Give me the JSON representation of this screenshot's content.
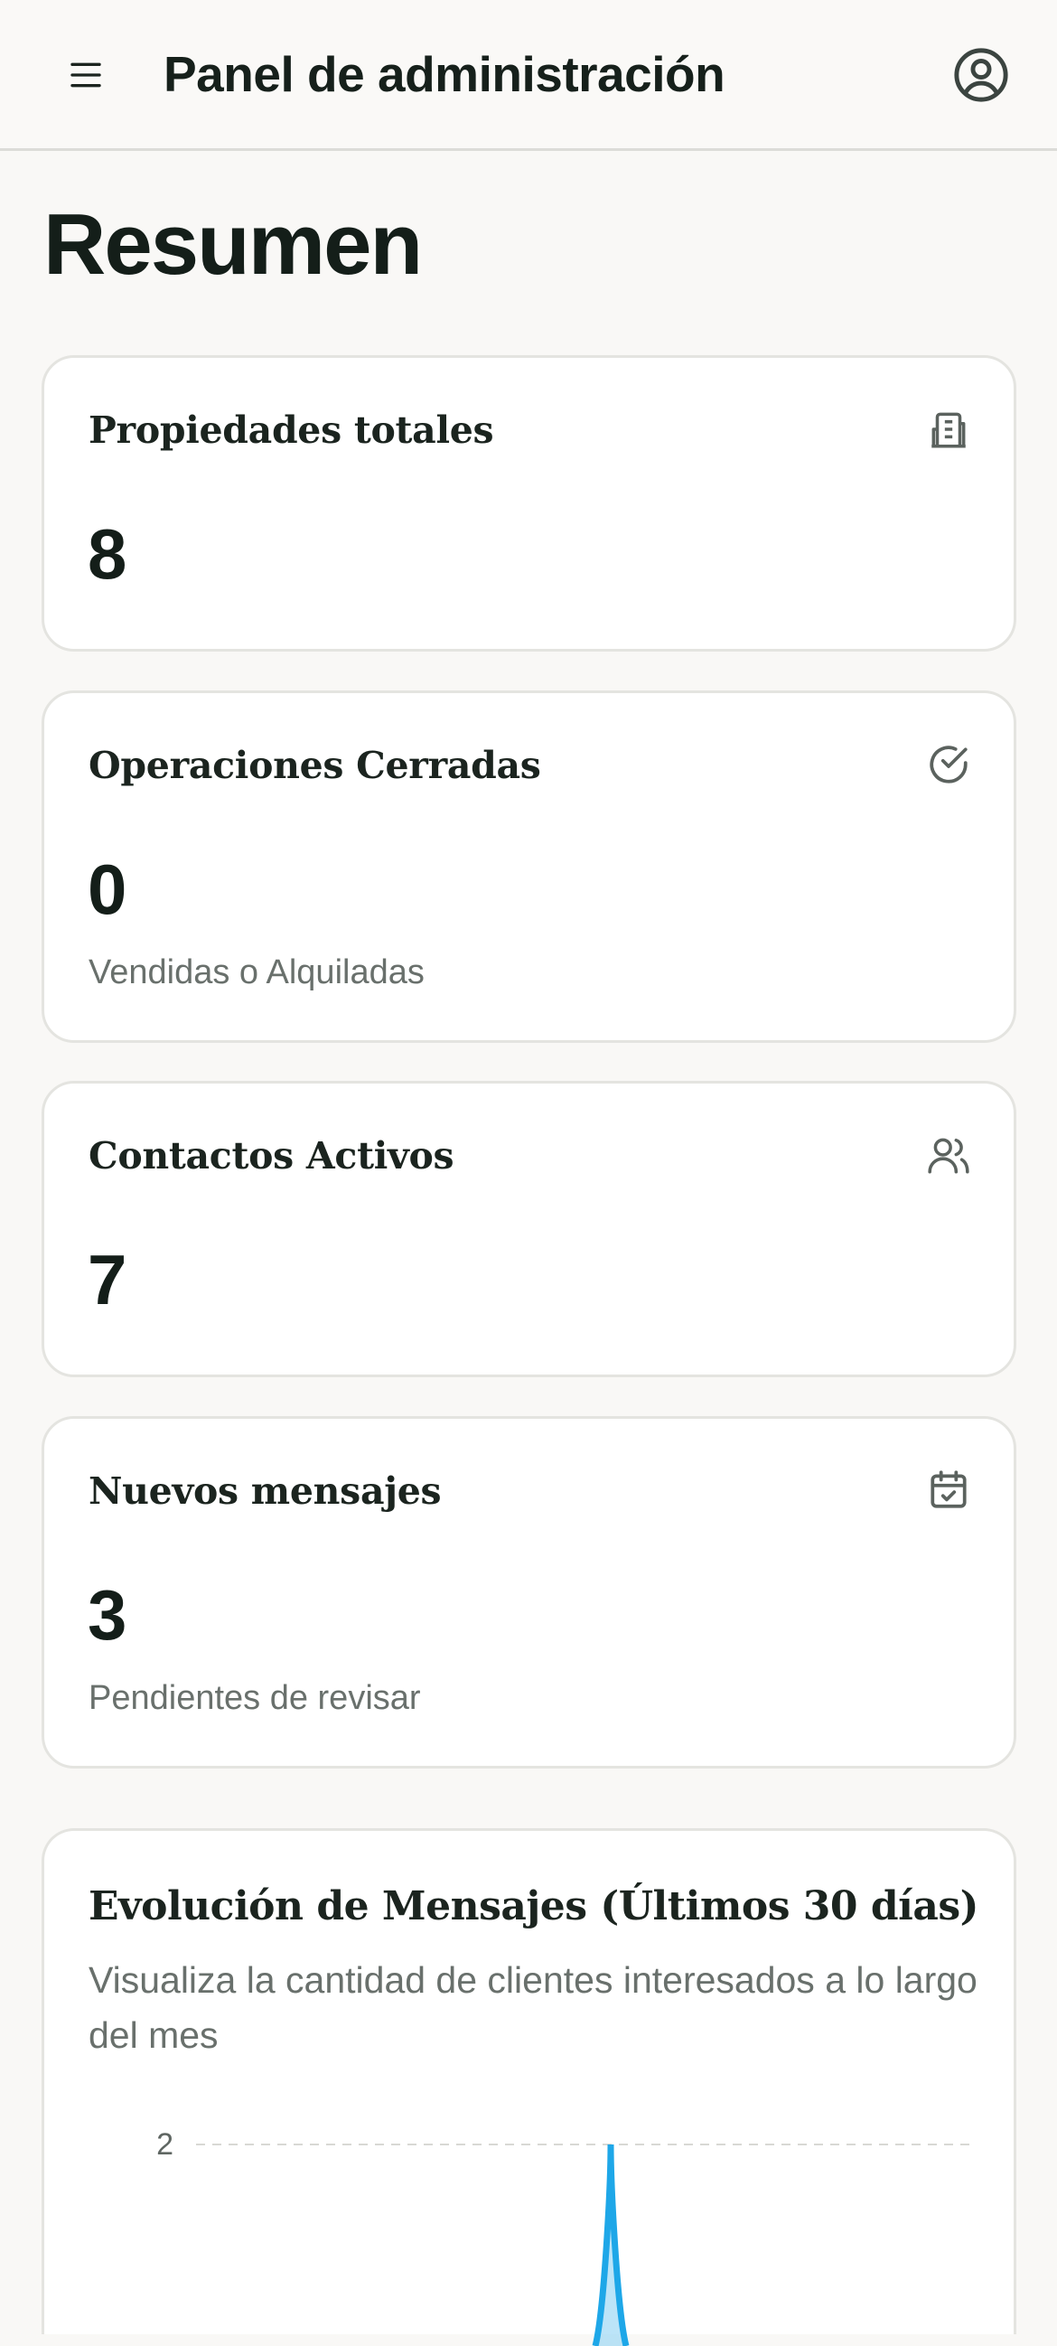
{
  "header": {
    "menu_icon": "menu-icon",
    "title": "Panel de administración",
    "account_icon": "user-circle-icon"
  },
  "page": {
    "title": "Resumen"
  },
  "stats": [
    {
      "title": "Propiedades totales",
      "value": "8",
      "subtitle": "",
      "icon": "building-icon"
    },
    {
      "title": "Operaciones Cerradas",
      "value": "0",
      "subtitle": "Vendidas o Alquiladas",
      "icon": "check-circle-icon"
    },
    {
      "title": "Contactos Activos",
      "value": "7",
      "subtitle": "",
      "icon": "users-icon"
    },
    {
      "title": "Nuevos mensajes",
      "value": "3",
      "subtitle": "Pendientes de revisar",
      "icon": "calendar-check-icon"
    }
  ],
  "chart_card": {
    "title": "Evolución de Mensajes (Últimos 30 días)",
    "description": "Visualiza la cantidad de clientes interesados a lo largo del mes"
  },
  "chart_data": {
    "type": "area",
    "title": "Evolución de Mensajes (Últimos 30 días)",
    "y_ticks_visible": [
      2
    ],
    "series": [
      {
        "color": "#1ea7e8",
        "visible_peak": 2
      }
    ],
    "grid": "dashed horizontal",
    "accent_color": "#1ea7e8"
  }
}
